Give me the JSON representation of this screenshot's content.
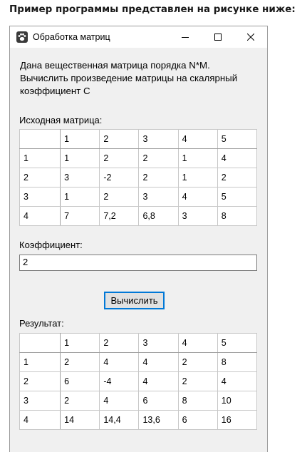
{
  "caption": "Пример программы представлен на рисунке ниже:",
  "window": {
    "title": "Обработка матриц",
    "app_icon": "paw-icon",
    "controls": [
      "minimize-icon",
      "maximize-icon",
      "close-icon"
    ]
  },
  "description": [
    "Дана вещественная матрица порядка N*M.",
    "Вычислить произведение матрицы на скалярный",
    "коэффициент C"
  ],
  "source": {
    "label": "Исходная матрица:",
    "columns": [
      "1",
      "2",
      "3",
      "4",
      "5"
    ],
    "rows": [
      {
        "head": "1",
        "cells": [
          "1",
          "2",
          "2",
          "1",
          "4"
        ]
      },
      {
        "head": "2",
        "cells": [
          "3",
          "-2",
          "2",
          "1",
          "2"
        ]
      },
      {
        "head": "3",
        "cells": [
          "1",
          "2",
          "3",
          "4",
          "5"
        ]
      },
      {
        "head": "4",
        "cells": [
          "7",
          "7,2",
          "6,8",
          "3",
          "8"
        ]
      }
    ]
  },
  "coefficient": {
    "label": "Коэффициент:",
    "value": "2"
  },
  "calc_button": "Вычислить",
  "result": {
    "label": "Результат:",
    "columns": [
      "1",
      "2",
      "3",
      "4",
      "5"
    ],
    "rows": [
      {
        "head": "1",
        "cells": [
          "2",
          "4",
          "4",
          "2",
          "8"
        ]
      },
      {
        "head": "2",
        "cells": [
          "6",
          "-4",
          "4",
          "2",
          "4"
        ]
      },
      {
        "head": "3",
        "cells": [
          "2",
          "4",
          "6",
          "8",
          "10"
        ]
      },
      {
        "head": "4",
        "cells": [
          "14",
          "14,4",
          "13,6",
          "6",
          "16"
        ]
      }
    ]
  }
}
